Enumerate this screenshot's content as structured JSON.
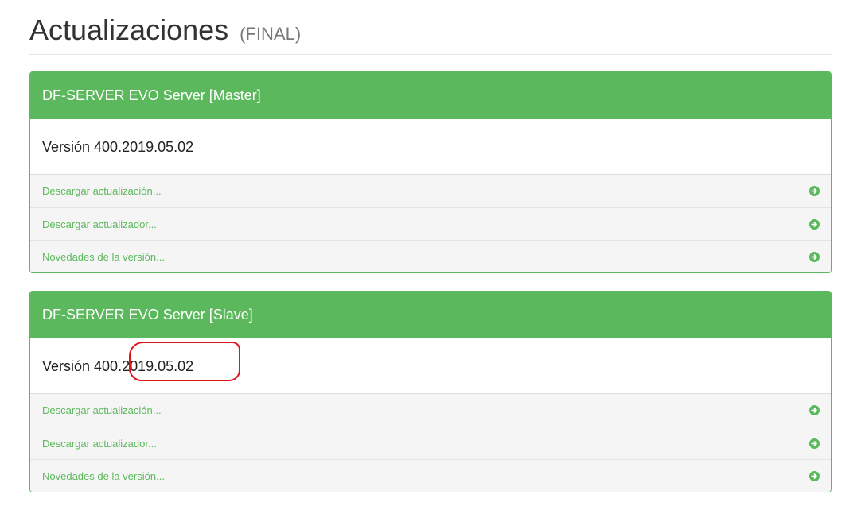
{
  "header": {
    "title": "Actualizaciones",
    "subtitle": "(FINAL)"
  },
  "panels": [
    {
      "heading": "DF-SERVER EVO Server [Master]",
      "version": "Versión 400.2019.05.02",
      "links": [
        {
          "label": "Descargar actualización...",
          "icon": "arrow-circle-right-icon"
        },
        {
          "label": "Descargar actualizador...",
          "icon": "arrow-circle-right-icon"
        },
        {
          "label": "Novedades de la versión...",
          "icon": "arrow-circle-right-icon"
        }
      ]
    },
    {
      "heading": "DF-SERVER EVO Server [Slave]",
      "version": "Versión 400.2019.05.02",
      "links": [
        {
          "label": "Descargar actualización...",
          "icon": "arrow-circle-right-icon"
        },
        {
          "label": "Descargar actualizador...",
          "icon": "arrow-circle-right-icon"
        },
        {
          "label": "Novedades de la versión...",
          "icon": "arrow-circle-right-icon"
        }
      ]
    }
  ],
  "colors": {
    "success_green": "#5cb85c",
    "highlight_red": "#e0151b"
  }
}
